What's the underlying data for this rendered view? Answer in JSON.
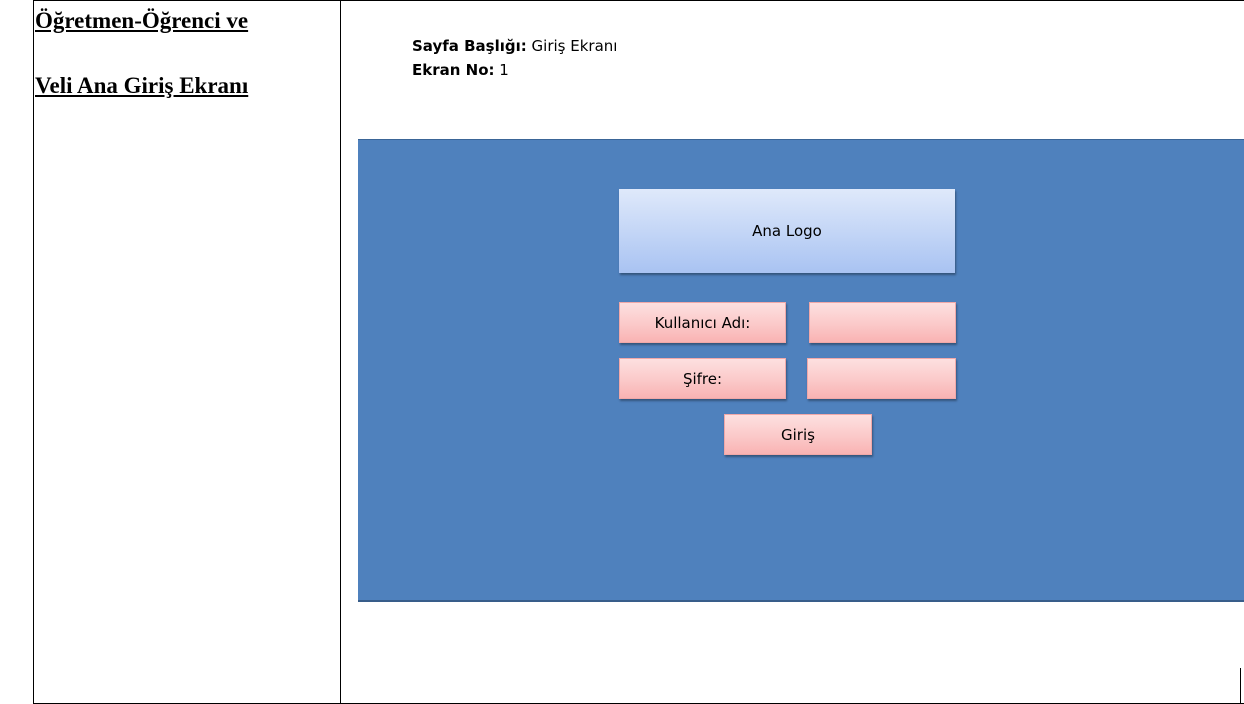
{
  "document": {
    "title_line1": "Öğretmen-Öğrenci ve",
    "title_line2": "Veli Ana Giriş Ekranı"
  },
  "meta": {
    "page_title_label": "Sayfa Başlığı:",
    "page_title_value": " Giriş Ekranı",
    "screen_no_label": "Ekran No:",
    "screen_no_value": " 1"
  },
  "mockup": {
    "logo_text": "Ana Logo",
    "username_label": "Kullanıcı Adı:",
    "username_value": "",
    "password_label": "Şifre:",
    "password_value": "",
    "login_button": "Giriş"
  },
  "colors": {
    "canvas": "#4f81bd",
    "logo": "#c4d6f6",
    "pink": "#fbc9c9"
  }
}
